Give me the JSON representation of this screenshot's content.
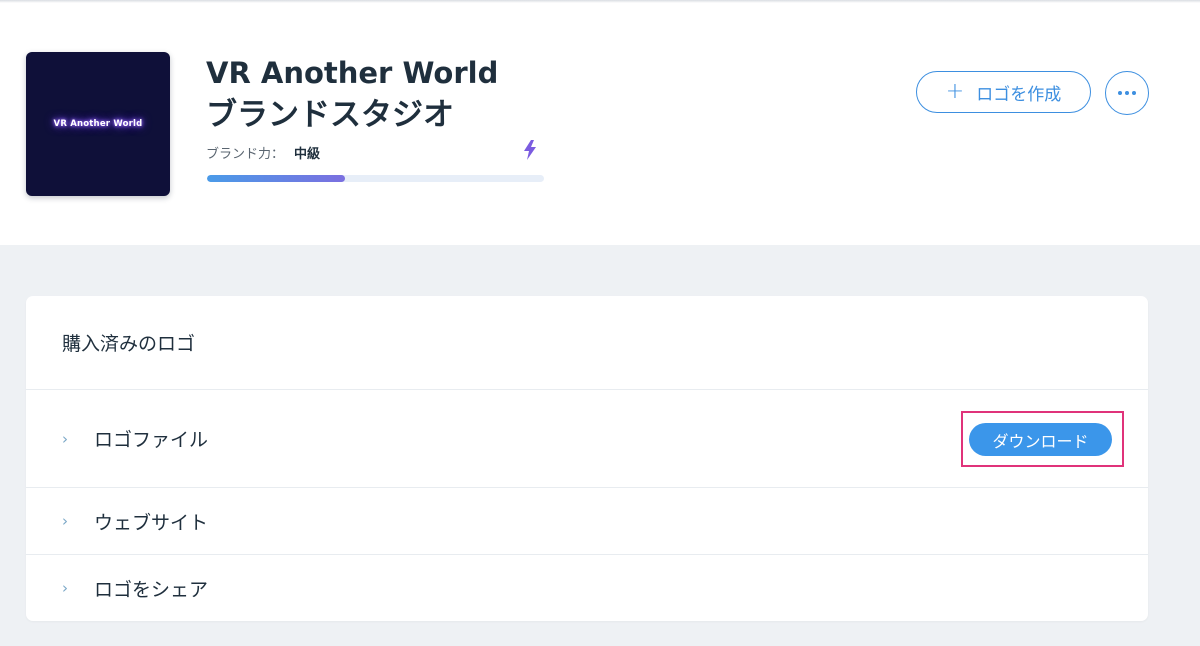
{
  "header": {
    "logo_text": "VR Another World",
    "title": "VR Another World",
    "subtitle": "ブランドスタジオ",
    "brand_power_label": "ブランド力：",
    "brand_power_value": "中級",
    "progress_fraction": 0.41,
    "create_logo_label": "ロゴを作成",
    "icons": {
      "bolt": "bolt-icon",
      "plus": "plus-icon",
      "more": "more-dots-icon"
    },
    "colors": {
      "accent": "#3d8fe0",
      "bolt": "#7b5ce0",
      "logo_bg": "#0f1039"
    }
  },
  "purchased": {
    "title": "購入済みのロゴ",
    "rows": [
      {
        "label": "ロゴファイル",
        "chevron": "›",
        "action_label": "ダウンロード"
      },
      {
        "label": "ウェブサイト",
        "chevron": "›"
      },
      {
        "label": "ロゴをシェア",
        "chevron": "›"
      }
    ],
    "colors": {
      "button": "#3b96ea",
      "highlight": "#e0337a"
    }
  }
}
